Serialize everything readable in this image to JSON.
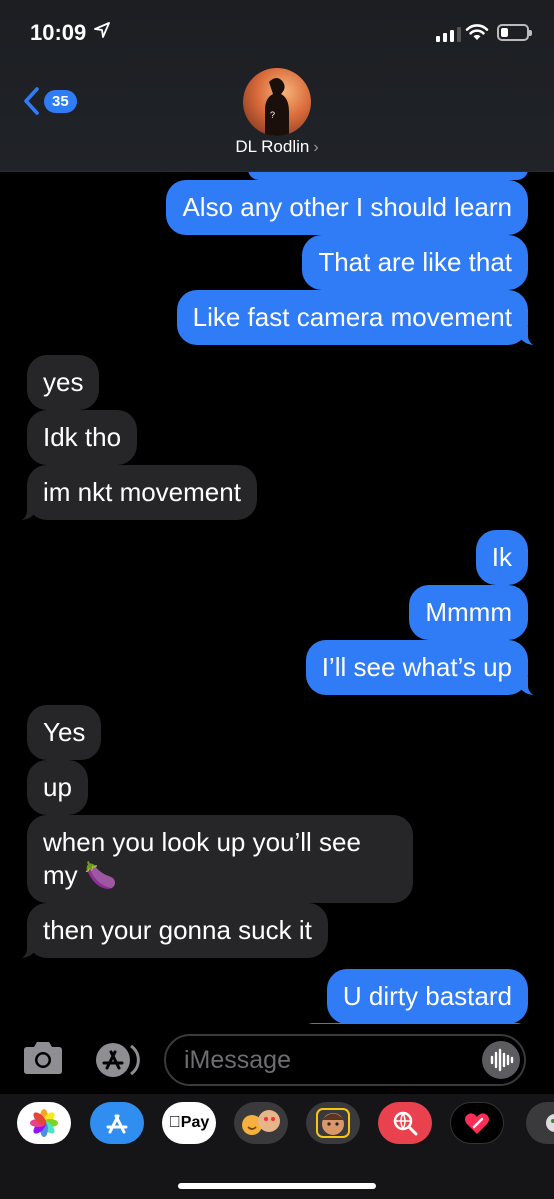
{
  "status_bar": {
    "time": "10:09"
  },
  "header": {
    "back_badge": "35",
    "contact_name": "DL Rodlin",
    "chevron": "›"
  },
  "messages": [
    {
      "from": "me",
      "text": "Also any other I should learn"
    },
    {
      "from": "me",
      "text": "That are like that"
    },
    {
      "from": "me",
      "text": "Like fast camera movement"
    },
    {
      "from": "them",
      "text": "yes"
    },
    {
      "from": "them",
      "text": "Idk tho"
    },
    {
      "from": "them",
      "text": "im nkt movement"
    },
    {
      "from": "me",
      "text": "Ik"
    },
    {
      "from": "me",
      "text": "Mmmm"
    },
    {
      "from": "me",
      "text": "I’ll see what’s up"
    },
    {
      "from": "them",
      "text": "Yes"
    },
    {
      "from": "them",
      "text": "up"
    },
    {
      "from": "them",
      "text": "when you look up you’ll see my 🍆"
    },
    {
      "from": "them",
      "text": "then your gonna suck it"
    },
    {
      "from": "me",
      "text": "U dirty bastard"
    }
  ],
  "input": {
    "placeholder": "iMessage"
  },
  "app_drawer": {
    "apps": [
      {
        "name": "photos-icon"
      },
      {
        "name": "app-store-icon"
      },
      {
        "name": "apple-pay-icon",
        "label": "Pay"
      },
      {
        "name": "memoji-stickers-icon"
      },
      {
        "name": "animoji-icon"
      },
      {
        "name": "image-search-icon"
      },
      {
        "name": "digital-touch-icon"
      },
      {
        "name": "more-apps-icon"
      }
    ]
  },
  "colors": {
    "sent_bubble": "#2f7cf6",
    "received_bubble": "#262628",
    "background": "#000000"
  }
}
